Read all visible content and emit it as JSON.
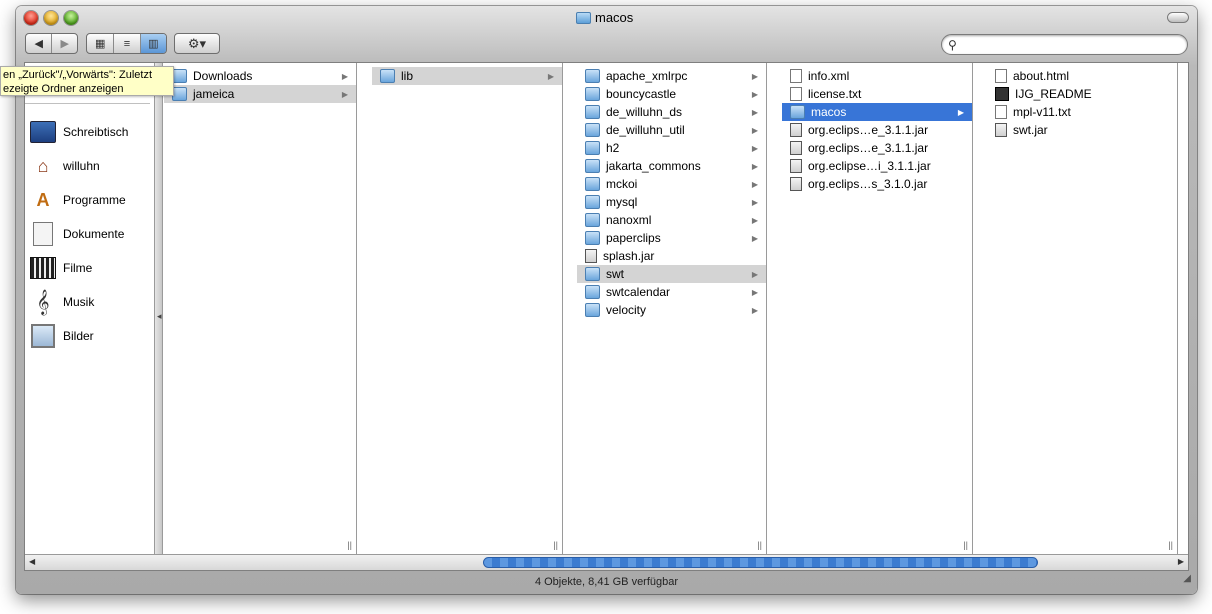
{
  "window": {
    "title": "macos"
  },
  "toolbar": {
    "back_icon": "◀",
    "forward_icon": "▶",
    "icon_view_icon": "▦",
    "list_view_icon": "≡",
    "column_view_icon": "▥",
    "action_icon": "⚙▾",
    "search_placeholder": ""
  },
  "tooltip": {
    "line1": "en „Zurück\"/„Vorwärts\": Zuletzt",
    "line2": "ezeigte Ordner anzeigen"
  },
  "sidebar": {
    "items": [
      {
        "label": "Schreibtisch",
        "icon": "desktop-icon"
      },
      {
        "label": "willuhn",
        "icon": "home-icon"
      },
      {
        "label": "Programme",
        "icon": "applications-icon"
      },
      {
        "label": "Dokumente",
        "icon": "documents-icon"
      },
      {
        "label": "Filme",
        "icon": "movies-icon"
      },
      {
        "label": "Musik",
        "icon": "music-icon"
      },
      {
        "label": "Bilder",
        "icon": "pictures-icon"
      }
    ]
  },
  "columns": [
    {
      "items": [
        {
          "label": "Downloads",
          "type": "folder"
        },
        {
          "label": "jameica",
          "type": "folder",
          "state": "gray"
        }
      ]
    },
    {
      "items": [
        {
          "label": "lib",
          "type": "folder",
          "state": "gray"
        }
      ]
    },
    {
      "items": [
        {
          "label": "apache_xmlrpc",
          "type": "folder"
        },
        {
          "label": "bouncycastle",
          "type": "folder"
        },
        {
          "label": "de_willuhn_ds",
          "type": "folder"
        },
        {
          "label": "de_willuhn_util",
          "type": "folder"
        },
        {
          "label": "h2",
          "type": "folder"
        },
        {
          "label": "jakarta_commons",
          "type": "folder"
        },
        {
          "label": "mckoi",
          "type": "folder"
        },
        {
          "label": "mysql",
          "type": "folder"
        },
        {
          "label": "nanoxml",
          "type": "folder"
        },
        {
          "label": "paperclips",
          "type": "folder"
        },
        {
          "label": "splash.jar",
          "type": "jar"
        },
        {
          "label": "swt",
          "type": "folder",
          "state": "gray"
        },
        {
          "label": "swtcalendar",
          "type": "folder"
        },
        {
          "label": "velocity",
          "type": "folder"
        }
      ]
    },
    {
      "items": [
        {
          "label": "info.xml",
          "type": "file"
        },
        {
          "label": "license.txt",
          "type": "file"
        },
        {
          "label": "macos",
          "type": "folder",
          "state": "blue"
        },
        {
          "label": "org.eclips…e_3.1.1.jar",
          "type": "jar"
        },
        {
          "label": "org.eclips…e_3.1.1.jar",
          "type": "jar"
        },
        {
          "label": "org.eclipse…i_3.1.1.jar",
          "type": "jar"
        },
        {
          "label": "org.eclips…s_3.1.0.jar",
          "type": "jar"
        }
      ]
    },
    {
      "items": [
        {
          "label": "about.html",
          "type": "file"
        },
        {
          "label": "IJG_README",
          "type": "unix"
        },
        {
          "label": "mpl-v11.txt",
          "type": "file"
        },
        {
          "label": "swt.jar",
          "type": "jar"
        }
      ]
    }
  ],
  "status": {
    "text": "4 Objekte, 8,41 GB verfügbar"
  }
}
